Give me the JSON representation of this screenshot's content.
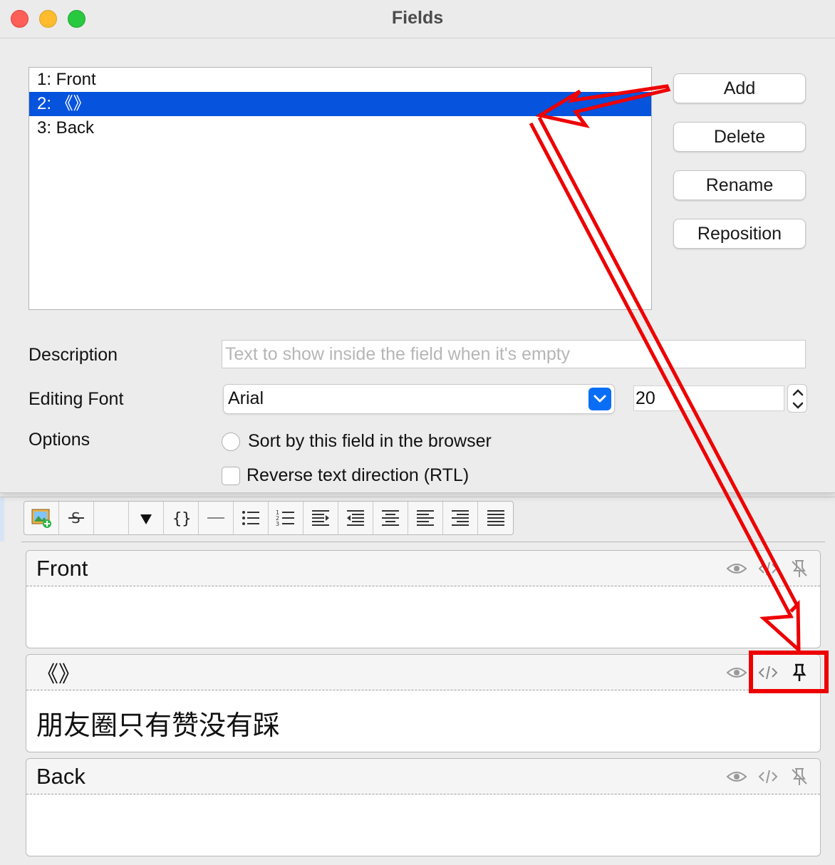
{
  "window": {
    "title": "Fields"
  },
  "field_list": [
    {
      "label": "1: Front",
      "selected": false
    },
    {
      "label": "2: 《》",
      "selected": true
    },
    {
      "label": "3: Back",
      "selected": false
    }
  ],
  "buttons": {
    "add": "Add",
    "delete": "Delete",
    "rename": "Rename",
    "reposition": "Reposition"
  },
  "form": {
    "description_label": "Description",
    "description_placeholder": "Text to show inside the field when it's empty",
    "description_value": "",
    "editing_font_label": "Editing Font",
    "font_value": "Arial",
    "font_size": "20",
    "options_label": "Options",
    "sort_option": "Sort by this field in the browser",
    "rtl_option": "Reverse text direction (RTL)"
  },
  "editor": {
    "toolbar": [
      "image-add-icon",
      "strikethrough-icon",
      "color-icon",
      "dropdown-arrow-icon",
      "cloze-braces-icon",
      "horizontal-rule-icon",
      "bullet-list-icon",
      "numbered-list-icon",
      "indent-icon",
      "outdent-icon",
      "align-center-icon",
      "align-left-icon",
      "align-right-icon",
      "justify-icon"
    ],
    "fields": [
      {
        "name": "Front",
        "content": "",
        "pinned": false
      },
      {
        "name": "《》",
        "content": "朋友圈只有赞没有踩",
        "pinned": true
      },
      {
        "name": "Back",
        "content": "",
        "pinned": false
      }
    ],
    "field_icons": [
      "eye-icon",
      "html-code-icon",
      "pin-icon"
    ]
  },
  "annotation_color": "#ee0000",
  "accent_color": "#0653dd"
}
